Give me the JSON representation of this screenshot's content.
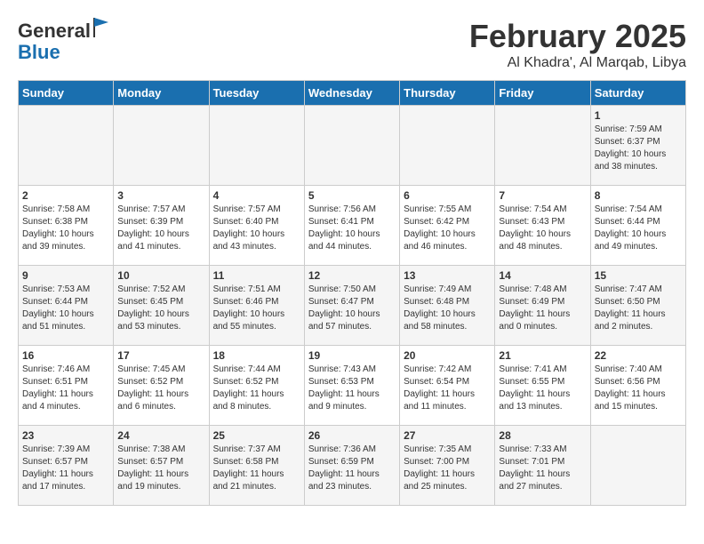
{
  "header": {
    "logo_line1": "General",
    "logo_line2": "Blue",
    "month_title": "February 2025",
    "location": "Al Khadra', Al Marqab, Libya"
  },
  "days_of_week": [
    "Sunday",
    "Monday",
    "Tuesday",
    "Wednesday",
    "Thursday",
    "Friday",
    "Saturday"
  ],
  "weeks": [
    [
      {
        "day": "",
        "info": ""
      },
      {
        "day": "",
        "info": ""
      },
      {
        "day": "",
        "info": ""
      },
      {
        "day": "",
        "info": ""
      },
      {
        "day": "",
        "info": ""
      },
      {
        "day": "",
        "info": ""
      },
      {
        "day": "1",
        "info": "Sunrise: 7:59 AM\nSunset: 6:37 PM\nDaylight: 10 hours\nand 38 minutes."
      }
    ],
    [
      {
        "day": "2",
        "info": "Sunrise: 7:58 AM\nSunset: 6:38 PM\nDaylight: 10 hours\nand 39 minutes."
      },
      {
        "day": "3",
        "info": "Sunrise: 7:57 AM\nSunset: 6:39 PM\nDaylight: 10 hours\nand 41 minutes."
      },
      {
        "day": "4",
        "info": "Sunrise: 7:57 AM\nSunset: 6:40 PM\nDaylight: 10 hours\nand 43 minutes."
      },
      {
        "day": "5",
        "info": "Sunrise: 7:56 AM\nSunset: 6:41 PM\nDaylight: 10 hours\nand 44 minutes."
      },
      {
        "day": "6",
        "info": "Sunrise: 7:55 AM\nSunset: 6:42 PM\nDaylight: 10 hours\nand 46 minutes."
      },
      {
        "day": "7",
        "info": "Sunrise: 7:54 AM\nSunset: 6:43 PM\nDaylight: 10 hours\nand 48 minutes."
      },
      {
        "day": "8",
        "info": "Sunrise: 7:54 AM\nSunset: 6:44 PM\nDaylight: 10 hours\nand 49 minutes."
      }
    ],
    [
      {
        "day": "9",
        "info": "Sunrise: 7:53 AM\nSunset: 6:44 PM\nDaylight: 10 hours\nand 51 minutes."
      },
      {
        "day": "10",
        "info": "Sunrise: 7:52 AM\nSunset: 6:45 PM\nDaylight: 10 hours\nand 53 minutes."
      },
      {
        "day": "11",
        "info": "Sunrise: 7:51 AM\nSunset: 6:46 PM\nDaylight: 10 hours\nand 55 minutes."
      },
      {
        "day": "12",
        "info": "Sunrise: 7:50 AM\nSunset: 6:47 PM\nDaylight: 10 hours\nand 57 minutes."
      },
      {
        "day": "13",
        "info": "Sunrise: 7:49 AM\nSunset: 6:48 PM\nDaylight: 10 hours\nand 58 minutes."
      },
      {
        "day": "14",
        "info": "Sunrise: 7:48 AM\nSunset: 6:49 PM\nDaylight: 11 hours\nand 0 minutes."
      },
      {
        "day": "15",
        "info": "Sunrise: 7:47 AM\nSunset: 6:50 PM\nDaylight: 11 hours\nand 2 minutes."
      }
    ],
    [
      {
        "day": "16",
        "info": "Sunrise: 7:46 AM\nSunset: 6:51 PM\nDaylight: 11 hours\nand 4 minutes."
      },
      {
        "day": "17",
        "info": "Sunrise: 7:45 AM\nSunset: 6:52 PM\nDaylight: 11 hours\nand 6 minutes."
      },
      {
        "day": "18",
        "info": "Sunrise: 7:44 AM\nSunset: 6:52 PM\nDaylight: 11 hours\nand 8 minutes."
      },
      {
        "day": "19",
        "info": "Sunrise: 7:43 AM\nSunset: 6:53 PM\nDaylight: 11 hours\nand 9 minutes."
      },
      {
        "day": "20",
        "info": "Sunrise: 7:42 AM\nSunset: 6:54 PM\nDaylight: 11 hours\nand 11 minutes."
      },
      {
        "day": "21",
        "info": "Sunrise: 7:41 AM\nSunset: 6:55 PM\nDaylight: 11 hours\nand 13 minutes."
      },
      {
        "day": "22",
        "info": "Sunrise: 7:40 AM\nSunset: 6:56 PM\nDaylight: 11 hours\nand 15 minutes."
      }
    ],
    [
      {
        "day": "23",
        "info": "Sunrise: 7:39 AM\nSunset: 6:57 PM\nDaylight: 11 hours\nand 17 minutes."
      },
      {
        "day": "24",
        "info": "Sunrise: 7:38 AM\nSunset: 6:57 PM\nDaylight: 11 hours\nand 19 minutes."
      },
      {
        "day": "25",
        "info": "Sunrise: 7:37 AM\nSunset: 6:58 PM\nDaylight: 11 hours\nand 21 minutes."
      },
      {
        "day": "26",
        "info": "Sunrise: 7:36 AM\nSunset: 6:59 PM\nDaylight: 11 hours\nand 23 minutes."
      },
      {
        "day": "27",
        "info": "Sunrise: 7:35 AM\nSunset: 7:00 PM\nDaylight: 11 hours\nand 25 minutes."
      },
      {
        "day": "28",
        "info": "Sunrise: 7:33 AM\nSunset: 7:01 PM\nDaylight: 11 hours\nand 27 minutes."
      },
      {
        "day": "",
        "info": ""
      }
    ]
  ]
}
